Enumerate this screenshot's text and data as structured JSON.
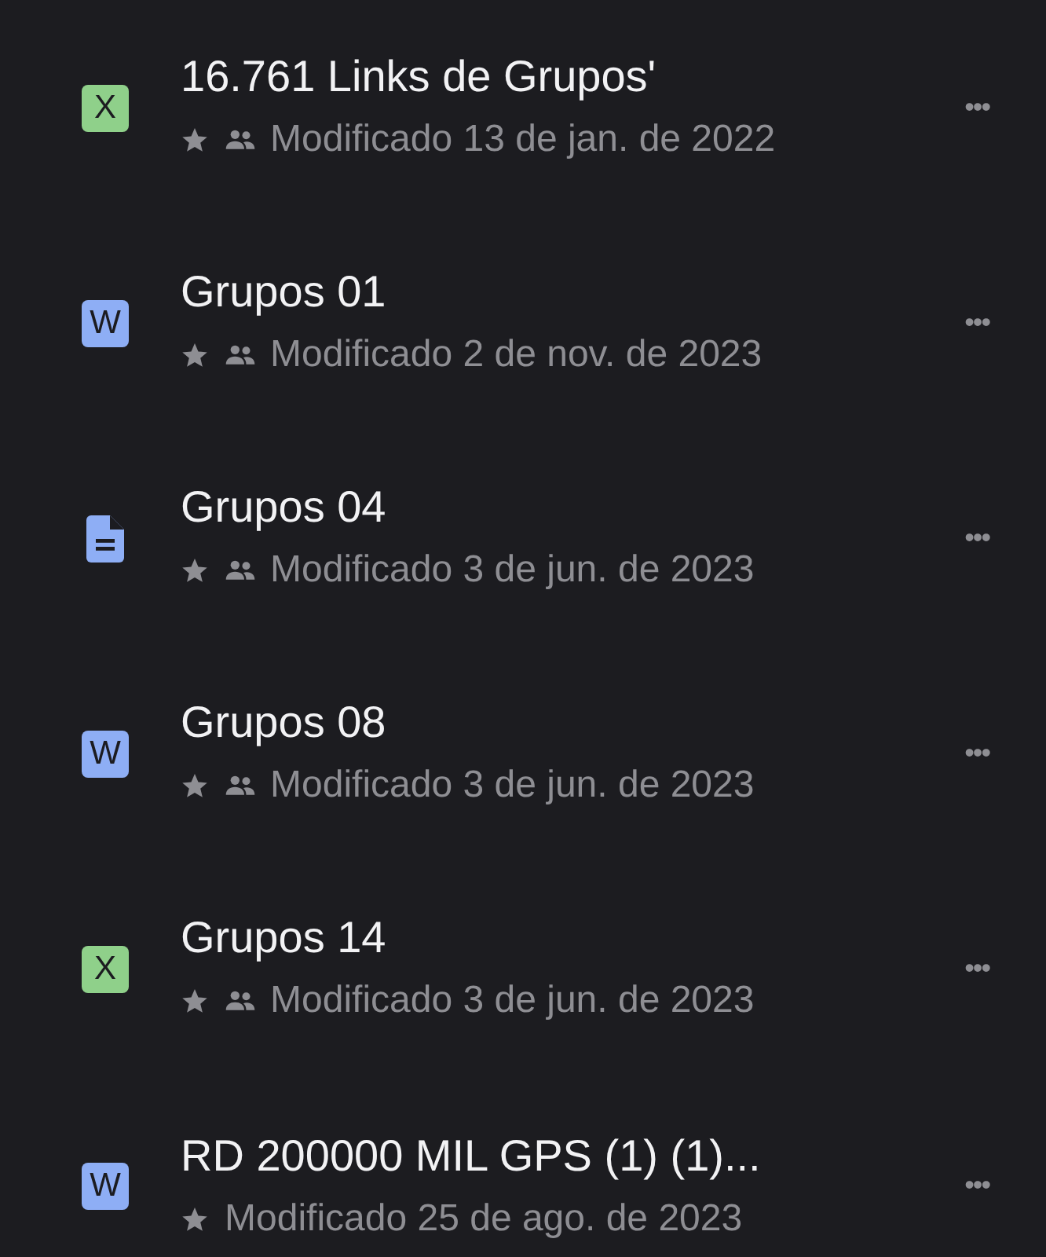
{
  "files": [
    {
      "kind": "sheet",
      "badge": "X",
      "title": "16.761 Links de Grupos'",
      "starred": true,
      "shared": true,
      "modified": "Modificado 13 de jan. de 2022",
      "more": "•••"
    },
    {
      "kind": "word",
      "badge": "W",
      "title": "Grupos 01",
      "starred": true,
      "shared": true,
      "modified": "Modificado 2 de nov. de 2023",
      "more": "•••"
    },
    {
      "kind": "doc",
      "title": "Grupos 04",
      "starred": true,
      "shared": true,
      "modified": "Modificado 3 de jun. de 2023",
      "more": "•••"
    },
    {
      "kind": "word",
      "badge": "W",
      "title": "Grupos 08",
      "starred": true,
      "shared": true,
      "modified": "Modificado 3 de jun. de 2023",
      "more": "•••"
    },
    {
      "kind": "sheet",
      "badge": "X",
      "title": "Grupos 14",
      "starred": true,
      "shared": true,
      "modified": "Modificado 3 de jun. de 2023",
      "more": "•••"
    },
    {
      "kind": "word",
      "badge": "W",
      "title": "RD 200000 MIL GPS (1) (1)...",
      "starred": true,
      "shared": false,
      "modified": "Modificado 25 de ago. de 2023",
      "more": "•••"
    }
  ]
}
